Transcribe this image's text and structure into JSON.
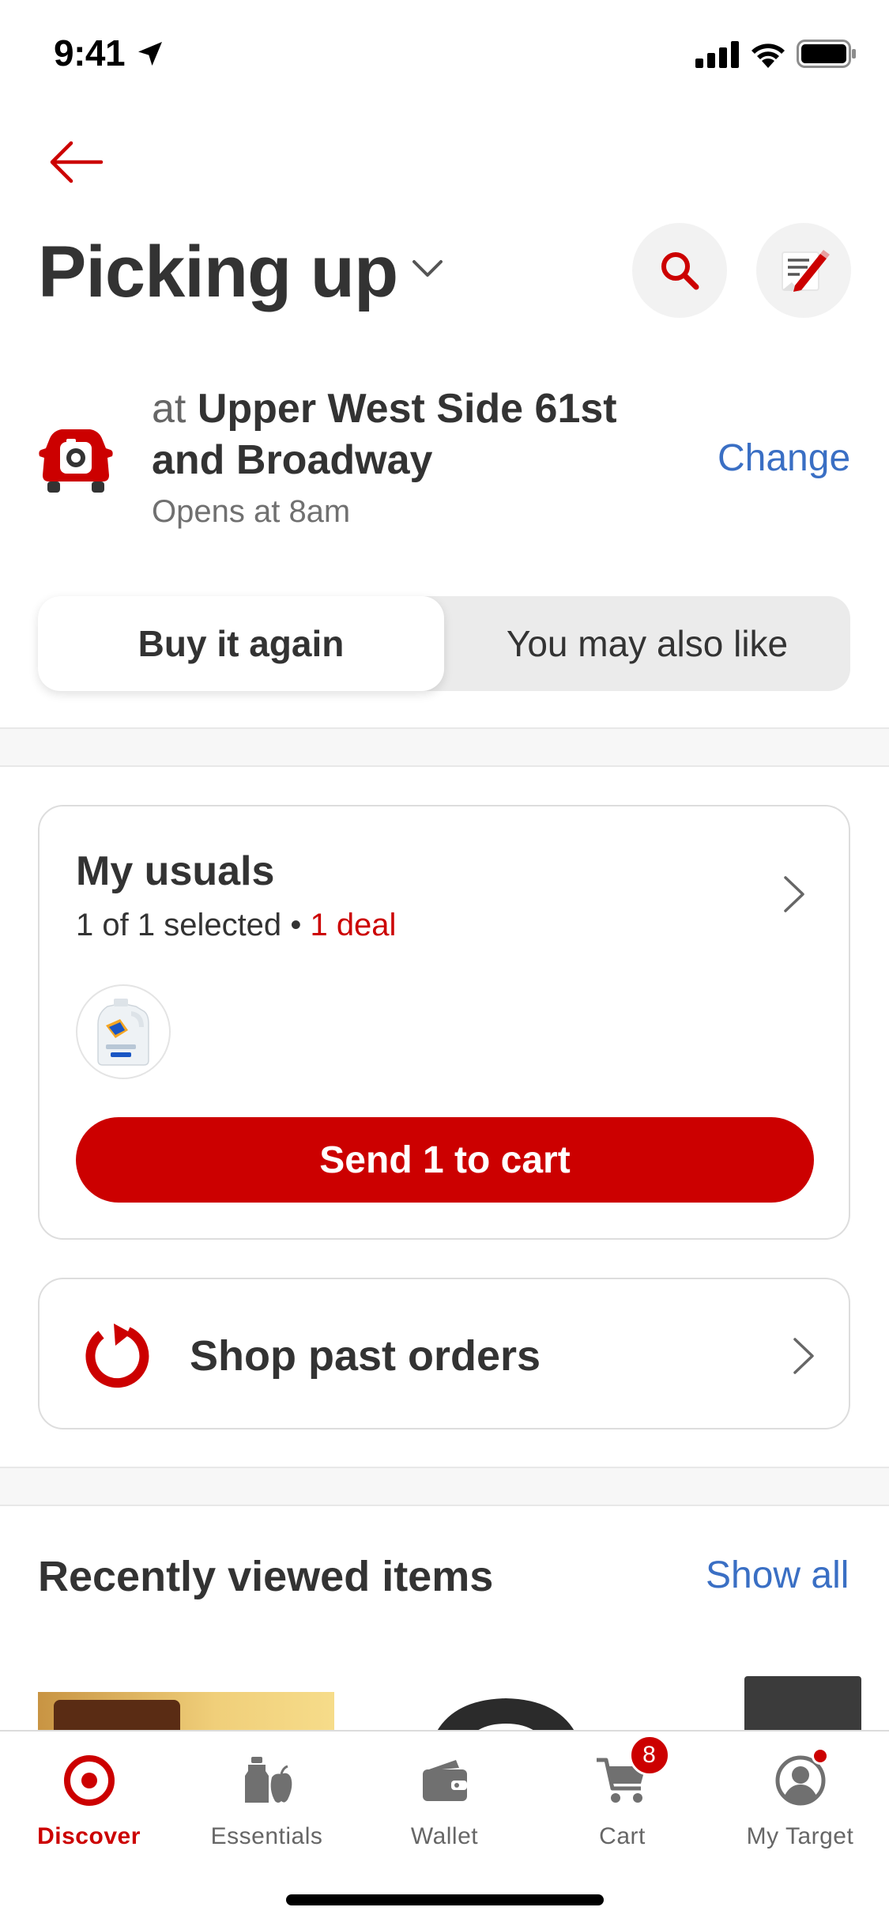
{
  "status_bar": {
    "time": "9:41",
    "icons": [
      "location-arrow-icon",
      "cellular-signal-icon",
      "wifi-icon",
      "battery-icon"
    ]
  },
  "header": {
    "back_icon": "back-arrow-icon",
    "title": "Picking up",
    "title_icon": "chevron-down-icon",
    "search_icon": "search-icon",
    "list_icon": "shopping-list-edit-icon"
  },
  "store": {
    "prefix": "at",
    "name": "Upper West Side 61st and Broadway",
    "hours": "Opens at 8am",
    "change_label": "Change",
    "icon": "drive-up-car-icon"
  },
  "segments": {
    "active": "Buy it again",
    "inactive": "You may also like"
  },
  "usuals": {
    "title": "My usuals",
    "selected_text": "1 of 1 selected",
    "separator": "•",
    "deal_text": "1 deal",
    "product_icon": "tide-detergent-thumbnail",
    "send_button": "Send 1 to cart"
  },
  "past_orders": {
    "label": "Shop past orders",
    "icon": "reorder-refresh-icon"
  },
  "recently_viewed": {
    "title": "Recently viewed items",
    "show_all": "Show all"
  },
  "tabbar": {
    "tabs": [
      {
        "label": "Discover",
        "icon": "target-bullseye-icon",
        "active": true
      },
      {
        "label": "Essentials",
        "icon": "essentials-icon",
        "active": false
      },
      {
        "label": "Wallet",
        "icon": "wallet-icon",
        "active": false
      },
      {
        "label": "Cart",
        "icon": "cart-icon",
        "active": false,
        "badge": "8"
      },
      {
        "label": "My Target",
        "icon": "profile-icon",
        "active": false
      }
    ]
  },
  "colors": {
    "brand_red": "#cc0000",
    "link_blue": "#3a6fc4",
    "text_dark": "#333333"
  }
}
